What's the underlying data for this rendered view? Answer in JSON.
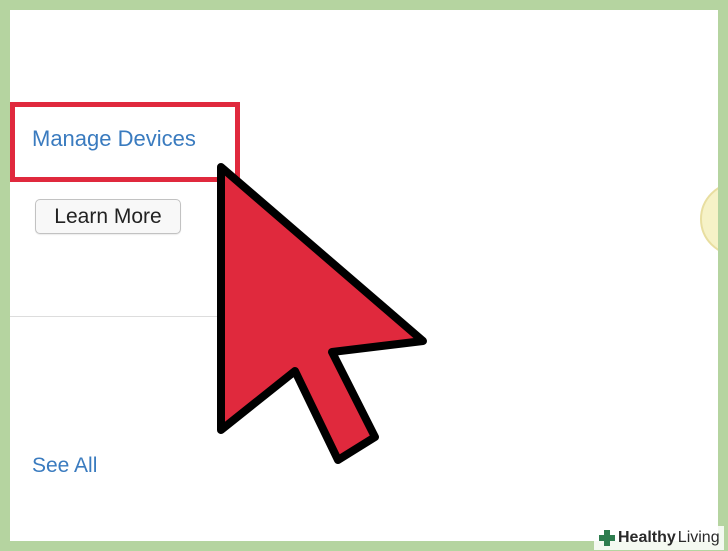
{
  "links": {
    "manage_devices": "Manage Devices",
    "see_all": "See All"
  },
  "buttons": {
    "learn_more": "Learn More"
  },
  "watermark": {
    "brand": "Healthy",
    "sub": "Living"
  },
  "colors": {
    "frame": "#b5d4a0",
    "link": "#3a7bbf",
    "highlight": "#e0293d",
    "cursor": "#e0293d"
  },
  "icons": {
    "cursor": "arrow-pointer-icon",
    "watermark": "plus-cross-icon"
  }
}
